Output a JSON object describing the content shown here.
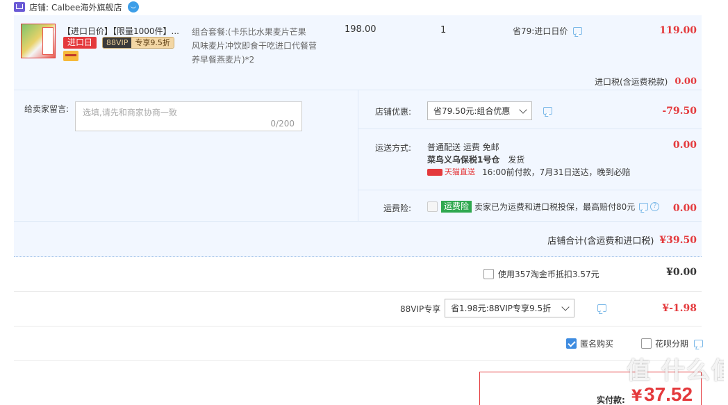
{
  "store": {
    "label": "店铺:",
    "name": "Calbee海外旗舰店"
  },
  "item": {
    "title": "【进口日价】【限量1000件】...",
    "tag_import_day": "进口日",
    "tag_88vip": "88VIP",
    "tag_discount": "专享9.5折",
    "spec_line1": "组合套餐:(卡乐比水果麦片芒果",
    "spec_line2": "风味麦片冲饮即食干吃进口代餐营",
    "spec_line3": "养早餐燕麦片)*2",
    "price": "198.00",
    "qty": "1",
    "promo": "省79:进口日价",
    "subtotal": "119.00"
  },
  "import_tax": {
    "label": "进口税(含运费税款)",
    "value": "0.00"
  },
  "message": {
    "label": "给卖家留言:",
    "placeholder": "选填,请先和商家协商一致",
    "counter": "0/200"
  },
  "shop_discount": {
    "label": "店铺优惠:",
    "selected": "省79.50元:组合优惠",
    "value": "-79.50"
  },
  "shipping": {
    "label": "运送方式:",
    "line1": "普通配送 运费 免邮",
    "warehouse": "菜鸟义乌保税1号仓",
    "ship_text": "发货",
    "tmall_badge": "天猫直送",
    "delivery": "16:00前付款，7月31日送达，晚到必赔",
    "value": "0.00"
  },
  "insurance": {
    "label": "运费险:",
    "badge": "运费险",
    "text": "卖家已为运费和进口税投保，最高赔付80元",
    "value": "0.00"
  },
  "shop_total": {
    "label": "店铺合计(含运费和进口税)",
    "value": "¥39.50"
  },
  "coins": {
    "label": "使用357淘金币抵扣3.57元",
    "value": "¥0.00"
  },
  "vip": {
    "label": "88VIP专享",
    "selected": "省1.98元:88VIP专享9.5折",
    "value": "¥-1.98"
  },
  "anonymous": {
    "label": "匿名购买"
  },
  "huabei": {
    "label": "花呗分期"
  },
  "pay": {
    "label": "实付款:",
    "currency": "¥",
    "value": "37.52"
  },
  "watermark": "值 什么值得买",
  "colors": {
    "accent_red": "#e4393c",
    "light_blue_bg": "#f2f7ff",
    "border_blue": "#b7d2f0"
  }
}
